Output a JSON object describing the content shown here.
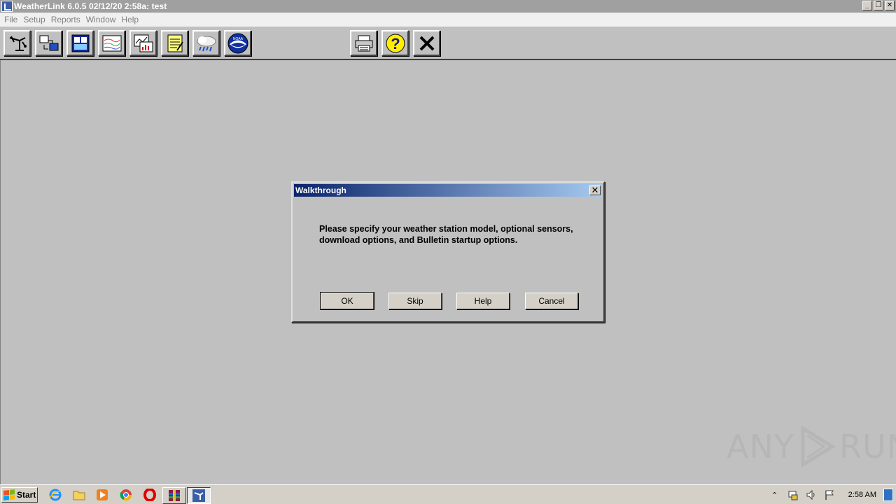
{
  "window": {
    "title": "WeatherLink 6.0.5  02/12/20  2:58a: test",
    "controls": [
      "minimize",
      "restore",
      "close"
    ]
  },
  "menu": {
    "items": [
      "File",
      "Setup",
      "Reports",
      "Window",
      "Help"
    ]
  },
  "toolbar": {
    "buttons": [
      {
        "name": "station-icon"
      },
      {
        "name": "download-icon"
      },
      {
        "name": "bulletin-icon"
      },
      {
        "name": "plot-icon"
      },
      {
        "name": "chart-icon"
      },
      {
        "name": "notes-icon"
      },
      {
        "name": "rain-cloud-icon"
      },
      {
        "name": "noaa-icon",
        "label": "NOAA"
      },
      {
        "name": "printer-icon"
      },
      {
        "name": "help-icon",
        "label": "?"
      },
      {
        "name": "exit-icon"
      }
    ]
  },
  "dialog": {
    "title": "Walkthrough",
    "message": "Please specify your weather station model, optional sensors, download options, and Bulletin startup options.",
    "buttons": {
      "ok": "OK",
      "skip": "Skip",
      "help": "Help",
      "cancel": "Cancel"
    }
  },
  "watermark": {
    "left": "ANY",
    "right": "RUN"
  },
  "taskbar": {
    "start_label": "Start",
    "clock": "2:58 AM"
  },
  "colors": {
    "desktop_gray": "#c0c0c0",
    "dialog_title_start": "#0a246a",
    "dialog_title_end": "#a6caf0"
  }
}
